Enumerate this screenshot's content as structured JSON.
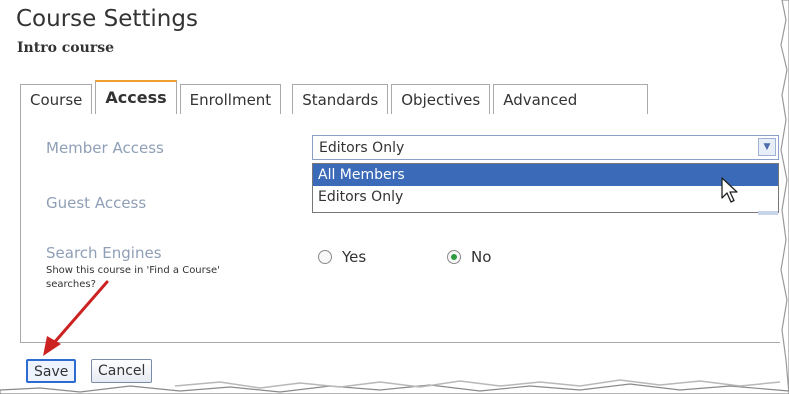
{
  "header": {
    "title": "Course Settings",
    "subtitle": "Intro course"
  },
  "tabs": [
    {
      "label": "Course"
    },
    {
      "label": "Access",
      "active": true
    },
    {
      "label": "Enrollment"
    },
    {
      "label": "Standards"
    },
    {
      "label": "Objectives"
    },
    {
      "label": "Advanced"
    }
  ],
  "form": {
    "member_access": {
      "label": "Member Access",
      "value": "Editors Only",
      "options": [
        "All Members",
        "Editors Only"
      ],
      "highlighted_option": "All Members"
    },
    "guest_access": {
      "label": "Guest Access"
    },
    "search_engines": {
      "label": "Search Engines",
      "help": "Show this course in 'Find a Course' searches?",
      "yes_label": "Yes",
      "no_label": "No",
      "selected": "No"
    }
  },
  "buttons": {
    "save": "Save",
    "cancel": "Cancel"
  },
  "colors": {
    "selection": "#3a6ab8",
    "active_tab_accent": "#f0a030",
    "annotation_arrow": "#cc2222"
  }
}
